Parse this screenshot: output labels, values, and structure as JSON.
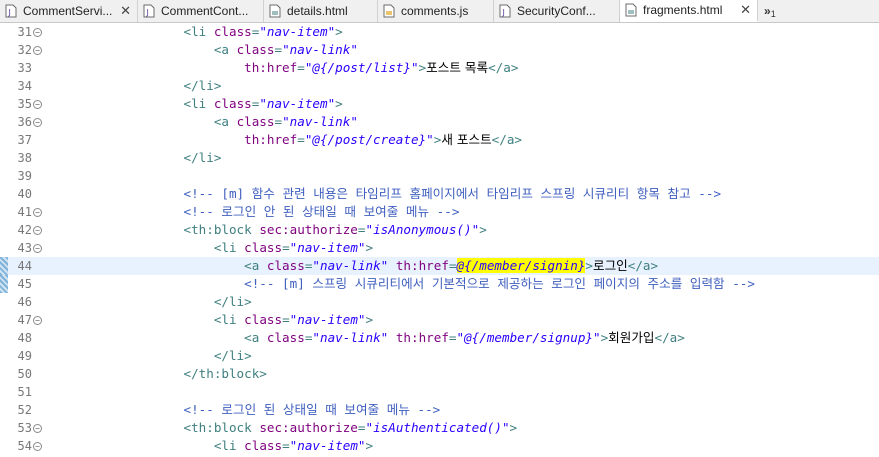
{
  "tabs": [
    {
      "label": "CommentServi...",
      "icon": "java-file-icon",
      "active": false,
      "closable": true,
      "width": 138
    },
    {
      "label": "CommentCont...",
      "icon": "java-file-icon",
      "active": false,
      "closable": false,
      "width": 126
    },
    {
      "label": "details.html",
      "icon": "html-file-icon",
      "active": false,
      "closable": false,
      "width": 114
    },
    {
      "label": "comments.js",
      "icon": "js-file-icon",
      "active": false,
      "closable": false,
      "width": 116
    },
    {
      "label": "SecurityConf...",
      "icon": "java-file-icon",
      "active": false,
      "closable": false,
      "width": 126
    },
    {
      "label": "fragments.html",
      "icon": "html-file-icon",
      "active": true,
      "closable": true,
      "width": 138
    }
  ],
  "overflow": {
    "glyph": "»",
    "count": "1"
  },
  "current_line": 44,
  "lines": [
    {
      "n": "31",
      "fold": true,
      "indent": "                  ",
      "segs": [
        [
          "tag",
          "<li "
        ],
        [
          "attr",
          "class"
        ],
        [
          "tag",
          "="
        ],
        [
          "str",
          "\"nav-item\""
        ],
        [
          "tag",
          ">"
        ]
      ]
    },
    {
      "n": "32",
      "fold": true,
      "indent": "                      ",
      "segs": [
        [
          "tag",
          "<a "
        ],
        [
          "attr",
          "class"
        ],
        [
          "tag",
          "="
        ],
        [
          "str",
          "\"nav-link\""
        ]
      ]
    },
    {
      "n": "33",
      "fold": false,
      "indent": "                          ",
      "segs": [
        [
          "attr",
          "th:href"
        ],
        [
          "tag",
          "="
        ],
        [
          "str",
          "\"@{/post/list}\""
        ],
        [
          "tag",
          ">"
        ],
        [
          "txt",
          "포스트 목록"
        ],
        [
          "tag",
          "</a>"
        ]
      ]
    },
    {
      "n": "34",
      "fold": false,
      "indent": "                  ",
      "segs": [
        [
          "tag",
          "</li>"
        ]
      ]
    },
    {
      "n": "35",
      "fold": true,
      "indent": "                  ",
      "segs": [
        [
          "tag",
          "<li "
        ],
        [
          "attr",
          "class"
        ],
        [
          "tag",
          "="
        ],
        [
          "str",
          "\"nav-item\""
        ],
        [
          "tag",
          ">"
        ]
      ]
    },
    {
      "n": "36",
      "fold": true,
      "indent": "                      ",
      "segs": [
        [
          "tag",
          "<a "
        ],
        [
          "attr",
          "class"
        ],
        [
          "tag",
          "="
        ],
        [
          "str",
          "\"nav-link\""
        ]
      ]
    },
    {
      "n": "37",
      "fold": false,
      "indent": "                          ",
      "segs": [
        [
          "attr",
          "th:href"
        ],
        [
          "tag",
          "="
        ],
        [
          "str",
          "\"@{/post/create}\""
        ],
        [
          "tag",
          ">"
        ],
        [
          "txt",
          "새 포스트"
        ],
        [
          "tag",
          "</a>"
        ]
      ]
    },
    {
      "n": "38",
      "fold": false,
      "indent": "                  ",
      "segs": [
        [
          "tag",
          "</li>"
        ]
      ]
    },
    {
      "n": "39",
      "fold": false,
      "indent": "",
      "segs": []
    },
    {
      "n": "40",
      "fold": false,
      "indent": "                  ",
      "segs": [
        [
          "cmt",
          "<!-- [m] 함수 관련 내용은 타임리프 홈페이지에서 타임리프 스프링 시큐리티 항목 참고 -->"
        ]
      ]
    },
    {
      "n": "41",
      "fold": true,
      "indent": "                  ",
      "segs": [
        [
          "cmt",
          "<!-- 로그인 안 된 상태일 때 보여줄 메뉴 -->"
        ]
      ]
    },
    {
      "n": "42",
      "fold": true,
      "indent": "                  ",
      "segs": [
        [
          "tag",
          "<th:block "
        ],
        [
          "attr",
          "sec:authorize"
        ],
        [
          "tag",
          "="
        ],
        [
          "str",
          "\"isAnonymous()\""
        ],
        [
          "tag",
          ">"
        ]
      ]
    },
    {
      "n": "43",
      "fold": true,
      "indent": "                      ",
      "segs": [
        [
          "tag",
          "<li "
        ],
        [
          "attr",
          "class"
        ],
        [
          "tag",
          "="
        ],
        [
          "str",
          "\"nav-item\""
        ],
        [
          "tag",
          ">"
        ]
      ]
    },
    {
      "n": "44",
      "fold": false,
      "indent": "                          ",
      "segs": [
        [
          "tag",
          "<a "
        ],
        [
          "attr",
          "class"
        ],
        [
          "tag",
          "="
        ],
        [
          "str",
          "\"nav-link\""
        ],
        [
          "tag",
          " "
        ],
        [
          "attr",
          "th:href"
        ],
        [
          "tag",
          "="
        ],
        [
          "str hl",
          "@{/member/signin}"
        ],
        [
          "tag",
          ">"
        ],
        [
          "txt",
          "로그인"
        ],
        [
          "tag",
          "</a>"
        ]
      ]
    },
    {
      "n": "45",
      "fold": false,
      "indent": "                          ",
      "segs": [
        [
          "cmt",
          "<!-- [m] 스프링 시큐리티에서 기본적으로 제공하는 로그인 페이지의 주소를 입력함 -->"
        ]
      ]
    },
    {
      "n": "46",
      "fold": false,
      "indent": "                      ",
      "segs": [
        [
          "tag",
          "</li>"
        ]
      ]
    },
    {
      "n": "47",
      "fold": true,
      "indent": "                      ",
      "segs": [
        [
          "tag",
          "<li "
        ],
        [
          "attr",
          "class"
        ],
        [
          "tag",
          "="
        ],
        [
          "str",
          "\"nav-item\""
        ],
        [
          "tag",
          ">"
        ]
      ]
    },
    {
      "n": "48",
      "fold": false,
      "indent": "                          ",
      "segs": [
        [
          "tag",
          "<a "
        ],
        [
          "attr",
          "class"
        ],
        [
          "tag",
          "="
        ],
        [
          "str",
          "\"nav-link\""
        ],
        [
          "tag",
          " "
        ],
        [
          "attr",
          "th:href"
        ],
        [
          "tag",
          "="
        ],
        [
          "str",
          "\"@{/member/signup}\""
        ],
        [
          "tag",
          ">"
        ],
        [
          "txt",
          "회원가입"
        ],
        [
          "tag",
          "</a>"
        ]
      ]
    },
    {
      "n": "49",
      "fold": false,
      "indent": "                      ",
      "segs": [
        [
          "tag",
          "</li>"
        ]
      ]
    },
    {
      "n": "50",
      "fold": false,
      "indent": "                  ",
      "segs": [
        [
          "tag",
          "</th:block>"
        ]
      ]
    },
    {
      "n": "51",
      "fold": false,
      "indent": "",
      "segs": []
    },
    {
      "n": "52",
      "fold": false,
      "indent": "                  ",
      "segs": [
        [
          "cmt",
          "<!-- 로그인 된 상태일 때 보여줄 메뉴 -->"
        ]
      ]
    },
    {
      "n": "53",
      "fold": true,
      "indent": "                  ",
      "segs": [
        [
          "tag",
          "<th:block "
        ],
        [
          "attr",
          "sec:authorize"
        ],
        [
          "tag",
          "="
        ],
        [
          "str",
          "\"isAuthenticated()\""
        ],
        [
          "tag",
          ">"
        ]
      ]
    },
    {
      "n": "54",
      "fold": true,
      "indent": "                      ",
      "segs": [
        [
          "tag",
          "<li "
        ],
        [
          "attr",
          "class"
        ],
        [
          "tag",
          "="
        ],
        [
          "str",
          "\"nav-item\""
        ],
        [
          "tag",
          ">"
        ]
      ]
    }
  ]
}
